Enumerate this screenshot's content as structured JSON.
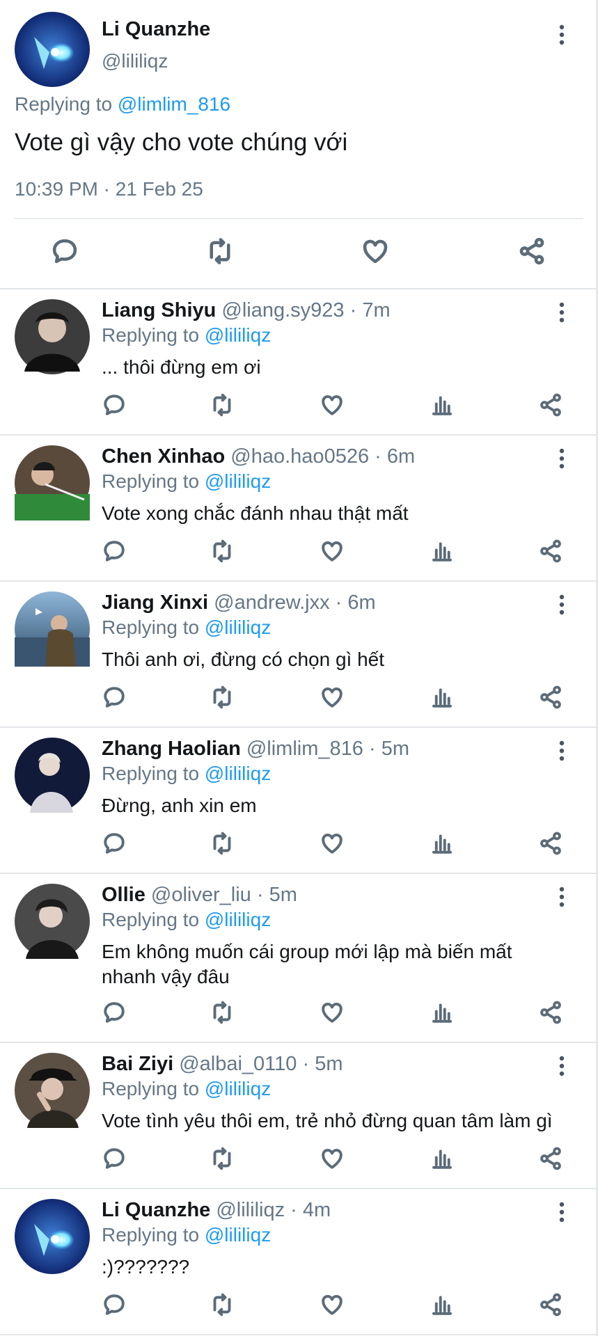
{
  "main_tweet": {
    "author_name": "Li Quanzhe",
    "author_handle": "@lililiqz",
    "replying_label": "Replying to",
    "replying_handle": "@limlim_816",
    "text": "Vote gì vậy cho vote chúng với",
    "timestamp": "10:39 PM · 21 Feb 25"
  },
  "replies": [
    {
      "name": "Liang Shiyu",
      "handle": "@liang.sy923",
      "time": "7m",
      "replying_label": "Replying to",
      "replying_handle": "@lililiqz",
      "text": "... thôi đừng em ơi"
    },
    {
      "name": "Chen Xinhao",
      "handle": "@hao.hao0526",
      "time": "6m",
      "replying_label": "Replying to",
      "replying_handle": "@lililiqz",
      "text": "Vote xong chắc đánh nhau thật mất"
    },
    {
      "name": "Jiang Xinxi",
      "handle": "@andrew.jxx",
      "time": "6m",
      "replying_label": "Replying to",
      "replying_handle": "@lililiqz",
      "text": "Thôi anh ơi, đừng có chọn gì hết"
    },
    {
      "name": "Zhang Haolian",
      "handle": "@limlim_816",
      "time": "5m",
      "replying_label": "Replying to",
      "replying_handle": "@lililiqz",
      "text": "Đừng, anh xin em"
    },
    {
      "name": "Ollie",
      "handle": "@oliver_liu",
      "time": "5m",
      "replying_label": "Replying to",
      "replying_handle": "@lililiqz",
      "text_line1": "Em không muốn cái group mới lập mà biến mất",
      "text_line2": "nhanh vậy đâu"
    },
    {
      "name": "Bai Ziyi",
      "handle": "@albai_0110",
      "time": "5m",
      "replying_label": "Replying to",
      "replying_handle": "@lililiqz",
      "text": "Vote tình yêu thôi em, trẻ nhỏ đừng quan tâm làm gì"
    },
    {
      "name": "Li Quanzhe",
      "handle": "@lililiqz",
      "time": "4m",
      "replying_label": "Replying to",
      "replying_handle": "@lililiqz",
      "text": ":)???????"
    }
  ],
  "icons": {
    "reply": "reply-icon",
    "retweet": "retweet-icon",
    "like": "like-icon",
    "views": "views-icon",
    "share": "share-icon",
    "more": "more-vertical-icon"
  },
  "colors": {
    "link": "#1d9bf0",
    "secondary_text": "#657786",
    "divider": "#e3e6e9"
  }
}
